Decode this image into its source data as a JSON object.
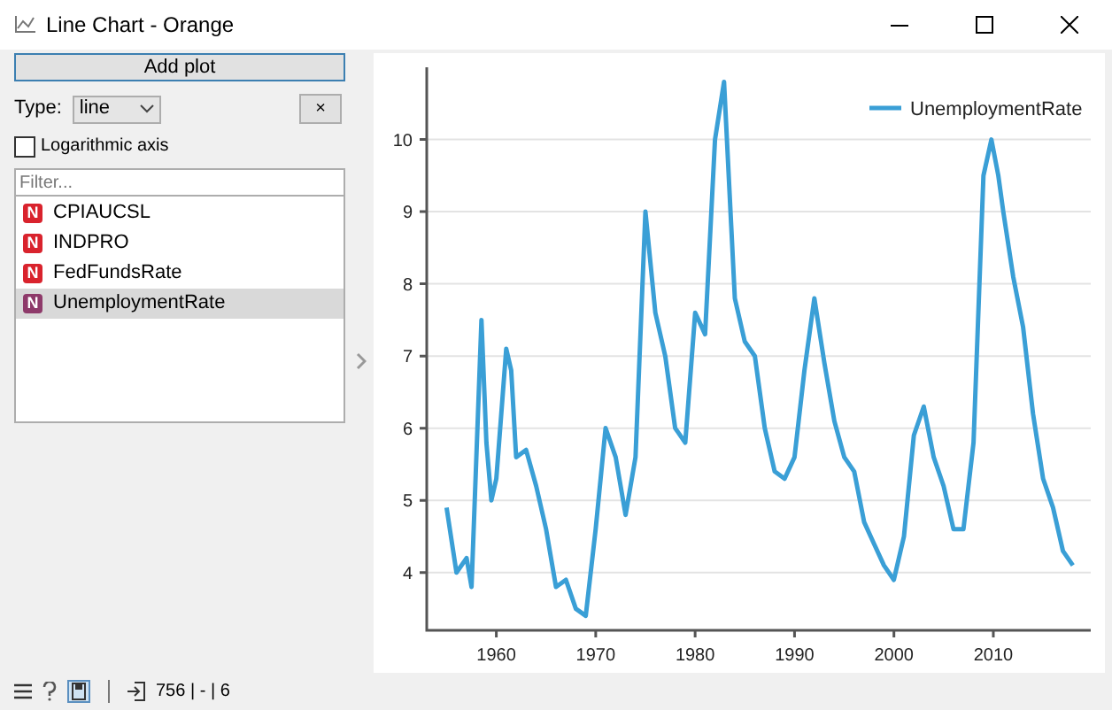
{
  "window": {
    "title": "Line Chart - Orange"
  },
  "controls": {
    "add_plot": "Add plot",
    "type_label": "Type:",
    "type_value": "line",
    "clear_button": "×",
    "log_axis": {
      "label": "Logarithmic axis",
      "checked": false
    },
    "filter": {
      "placeholder": "Filter..."
    }
  },
  "variables": [
    {
      "badge": "N",
      "name": "CPIAUCSL",
      "selected": false
    },
    {
      "badge": "N",
      "name": "INDPRO",
      "selected": false
    },
    {
      "badge": "N",
      "name": "FedFundsRate",
      "selected": false
    },
    {
      "badge": "N",
      "name": "UnemploymentRate",
      "selected": true
    }
  ],
  "plot": {
    "chart_data": {
      "type": "line",
      "x": [
        1955,
        1956,
        1957,
        1957.5,
        1958.5,
        1959,
        1959.5,
        1960,
        1961,
        1961.5,
        1962,
        1963,
        1964,
        1965,
        1966,
        1967,
        1968,
        1969,
        1970,
        1971,
        1972,
        1973,
        1974,
        1975,
        1976,
        1977,
        1978,
        1979,
        1980,
        1981,
        1982,
        1982.9,
        1984,
        1985,
        1986,
        1987,
        1988,
        1989,
        1990,
        1991,
        1992,
        1993,
        1994,
        1995,
        1996,
        1997,
        1998,
        1999,
        2000,
        2001,
        2002,
        2003,
        2004,
        2005,
        2006,
        2007,
        2008,
        2009,
        2009.8,
        2010.5,
        2011,
        2012,
        2013,
        2014,
        2015,
        2016,
        2017,
        2018
      ],
      "series": [
        {
          "name": "UnemploymentRate",
          "color": "#3a9fd6",
          "values": [
            4.9,
            4.0,
            4.2,
            3.8,
            7.5,
            5.8,
            5.0,
            5.3,
            7.1,
            6.8,
            5.6,
            5.7,
            5.2,
            4.6,
            3.8,
            3.9,
            3.5,
            3.4,
            4.6,
            6.0,
            5.6,
            4.8,
            5.6,
            9.0,
            7.6,
            7.0,
            6.0,
            5.8,
            7.6,
            7.3,
            10.0,
            10.8,
            7.8,
            7.2,
            7.0,
            6.0,
            5.4,
            5.3,
            5.6,
            6.8,
            7.8,
            6.9,
            6.1,
            5.6,
            5.4,
            4.7,
            4.4,
            4.1,
            3.9,
            4.5,
            5.9,
            6.3,
            5.6,
            5.2,
            4.6,
            4.6,
            5.8,
            9.5,
            10.0,
            9.5,
            9.0,
            8.1,
            7.4,
            6.2,
            5.3,
            4.9,
            4.3,
            4.1
          ]
        }
      ],
      "xlim": [
        1953,
        2019.8
      ],
      "ylim": [
        3.2,
        11
      ],
      "xticks": [
        1960,
        1970,
        1980,
        1990,
        2000,
        2010
      ],
      "yticks": [
        4,
        5,
        6,
        7,
        8,
        9,
        10
      ],
      "grid": true
    }
  },
  "status_bar": {
    "text": "756 | - | 6"
  }
}
